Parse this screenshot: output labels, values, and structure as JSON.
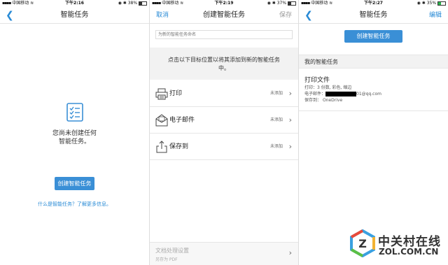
{
  "colors": {
    "accent": "#2a8bd6",
    "button": "#3a8fd6",
    "gray_band": "#f2f2f2",
    "battery": "#2ab34a"
  },
  "panel1": {
    "status": {
      "carrier": "中国移动 ",
      "time": "下午2:16",
      "battery": "38%"
    },
    "back_icon": "chevron-left-icon",
    "title": "智能任务",
    "empty_icon": "checklist-icon",
    "empty_line1": "您尚未创建任何",
    "empty_line2": "智能任务。",
    "create_button": "创建智能任务",
    "learn_more": "什么是智能任务？了解更多信息。"
  },
  "panel2": {
    "status": {
      "carrier": "中国移动 ",
      "time": "下午2:19",
      "battery": "37%"
    },
    "cancel": "取消",
    "title": "创建智能任务",
    "save": "保存",
    "name_placeholder": "为新的智能任务命名",
    "instruction": "点击以下目标位置以将其添加到新的智能任务中。",
    "targets": [
      {
        "icon": "printer-icon",
        "label": "打印",
        "status": "未添加"
      },
      {
        "icon": "email-icon",
        "label": "电子邮件",
        "status": "未添加"
      },
      {
        "icon": "share-icon",
        "label": "保存到",
        "status": "未添加"
      }
    ],
    "doc_settings": {
      "title": "文档处理设置",
      "subtitle": "另存为 PDF"
    }
  },
  "panel3": {
    "status": {
      "carrier": "中国移动 ",
      "time": "下午2:27",
      "battery": "35%"
    },
    "title": "智能任务",
    "edit": "编辑",
    "create_button": "创建智能任务",
    "section_title": "我的智能任务",
    "task": {
      "name": "打印文件",
      "print_label": "打印：",
      "print_value": "3 份数, 彩色, 缩边",
      "email_label": "电子邮件：",
      "email_value": "01@qq.com",
      "save_label": "保存到：",
      "save_value": "OneDrive"
    }
  },
  "watermark": {
    "text_cn": "中关村在线",
    "text_en": "ZOL.COM.CN"
  }
}
